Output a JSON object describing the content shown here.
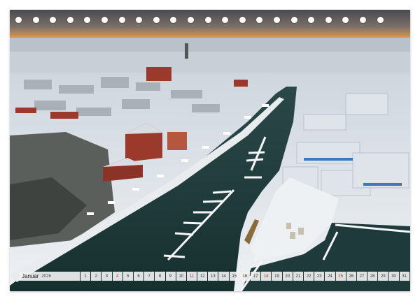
{
  "calendar": {
    "month": "Januar",
    "year": "2026",
    "days": [
      "1",
      "2",
      "3",
      "4",
      "5",
      "6",
      "7",
      "8",
      "9",
      "10",
      "11",
      "12",
      "13",
      "14",
      "15",
      "16",
      "17",
      "18",
      "19",
      "20",
      "21",
      "22",
      "23",
      "24",
      "25",
      "26",
      "27",
      "28",
      "29",
      "30",
      "31"
    ],
    "sundays": [
      "4",
      "11",
      "18",
      "25"
    ]
  },
  "photo": {
    "subject": "aerial-winter-harbor-town",
    "colors": {
      "water": "#1f3a3a",
      "snow": "#eef1f4",
      "brick": "#9b3a2c",
      "sky": "#4a4a50",
      "sunset": "#f2a14a"
    }
  },
  "binding": {
    "ring_count": 22
  }
}
